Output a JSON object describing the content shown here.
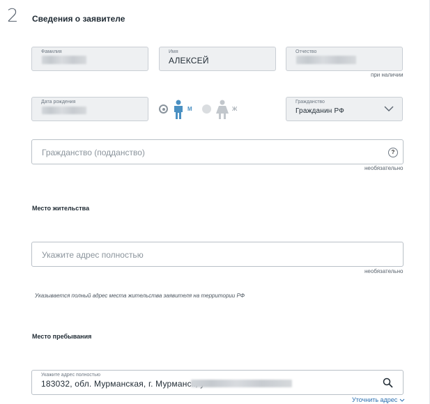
{
  "section": {
    "number": "2",
    "title": "Сведения о заявителе"
  },
  "surname": {
    "label": "Фамилия"
  },
  "name": {
    "label": "Имя",
    "value": "АЛЕКСЕЙ"
  },
  "patronymic": {
    "label": "Отчество",
    "hint": "при наличии"
  },
  "birthdate": {
    "label": "Дата рождения"
  },
  "gender": {
    "male": "М",
    "female": "Ж",
    "selected": "male",
    "icons": [
      "male-person-icon",
      "female-person-icon"
    ],
    "colors": {
      "active": "#4a90c2",
      "inactive": "#c2c7cc"
    }
  },
  "citizenship": {
    "label": "Гражданство",
    "value": "Гражданин РФ",
    "icon": "chevron-down-icon"
  },
  "citizenship_other": {
    "placeholder": "Гражданство (подданство)",
    "help": "?",
    "hint": "необязательно"
  },
  "residence": {
    "heading": "Место жительства",
    "placeholder": "Укажите адрес полностью",
    "hint": "необязательно",
    "note": "Указывается полный адрес места жительства заявителя на территории РФ"
  },
  "stay": {
    "heading": "Место пребывания",
    "label": "Укажите адрес полностью",
    "value": "183032, обл. Мурманская, г. Мурманск, у",
    "icon": "search-icon",
    "link": "Уточнить адрес"
  }
}
